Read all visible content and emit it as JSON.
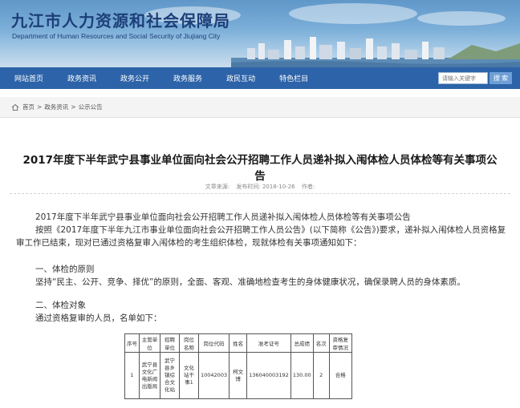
{
  "header": {
    "site_title": "九江市人力资源和社会保障局",
    "site_subtitle": "Department of Human Resources and Social Security of Jiujiang City"
  },
  "nav": {
    "items": [
      "网站首页",
      "政务资讯",
      "政务公开",
      "政务服务",
      "政民互动",
      "特色栏目"
    ],
    "search_placeholder": "请输入关键字",
    "search_button": "搜 索"
  },
  "breadcrumb": {
    "items": [
      "首页",
      "政务资讯",
      "公示公告"
    ],
    "separator": ">"
  },
  "article": {
    "title": "2017年度下半年武宁县事业单位面向社会公开招聘工作人员递补拟入闱体检人员体检等有关事项公告",
    "meta_source": "文章来源:",
    "meta_time": "发布时间: 2018-10-26",
    "meta_author": "作者:",
    "p1": "2017年度下半年武宁县事业单位面向社会公开招聘工作人员递补拟入闱体检人员体检等有关事项公告",
    "p2": "按照《2017年度下半年九江市事业单位面向社会公开招聘工作人员公告》(以下简称《公告》)要求，递补拟入闱体检人员资格复审工作已结束，现对已通过资格复审入闱体检的考生组织体检，现就体检有关事项通知如下：",
    "p3": "一、体检的原则",
    "p4": "坚持“民主、公开、竞争、择优”的原则，全面、客观、准确地检查考生的身体健康状况，确保录聘人员的身体素质。",
    "p5": "二、体检对象",
    "p6": "通过资格复审的人员，名单如下："
  },
  "table": {
    "headers": [
      "序号",
      "主管单位",
      "招聘单位",
      "岗位名称",
      "岗位代码",
      "姓名",
      "准考证号",
      "总成绩",
      "名次",
      "资格复审情况"
    ],
    "row": [
      "1",
      "武宁县文化广电新闻出版局",
      "武宁县乡镇综合文化站",
      "文化站干事1",
      "10042003",
      "柯文博",
      "136040003192",
      "130.00",
      "2",
      "合格"
    ]
  }
}
